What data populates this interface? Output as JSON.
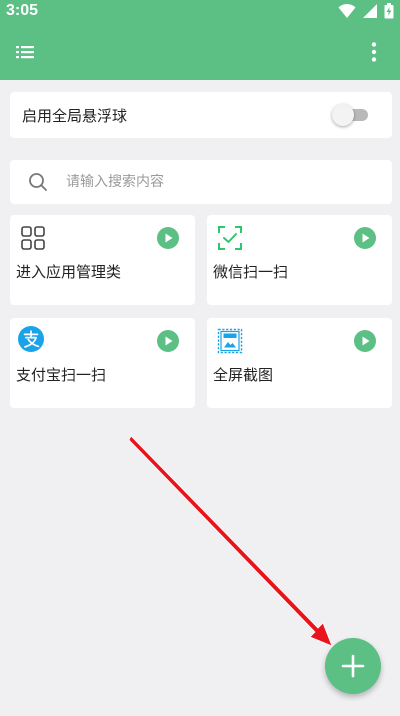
{
  "status_bar": {
    "time": "3:05",
    "icons": [
      "wifi-icon",
      "signal-icon",
      "battery-icon"
    ]
  },
  "app_bar": {
    "menu_icon": "list-menu-icon",
    "more_icon": "more-vert-icon"
  },
  "floating_ball": {
    "label": "启用全局悬浮球",
    "enabled": false
  },
  "search": {
    "placeholder": "请输入搜索内容",
    "value": ""
  },
  "shortcuts": [
    {
      "label": "进入应用管理类",
      "icon": "app-grid-icon"
    },
    {
      "label": "微信扫一扫",
      "icon": "wechat-scan-icon"
    },
    {
      "label": "支付宝扫一扫",
      "icon": "alipay-icon"
    },
    {
      "label": "全屏截图",
      "icon": "app-screenshot-icon"
    }
  ],
  "fab": {
    "icon": "plus-icon"
  },
  "colors": {
    "brand": "#5cbf84",
    "play_green": "#5cbf84",
    "alipay_blue": "#1aa3e8",
    "wechat_green": "#2dc86c",
    "arrow_red": "#e8141c"
  }
}
